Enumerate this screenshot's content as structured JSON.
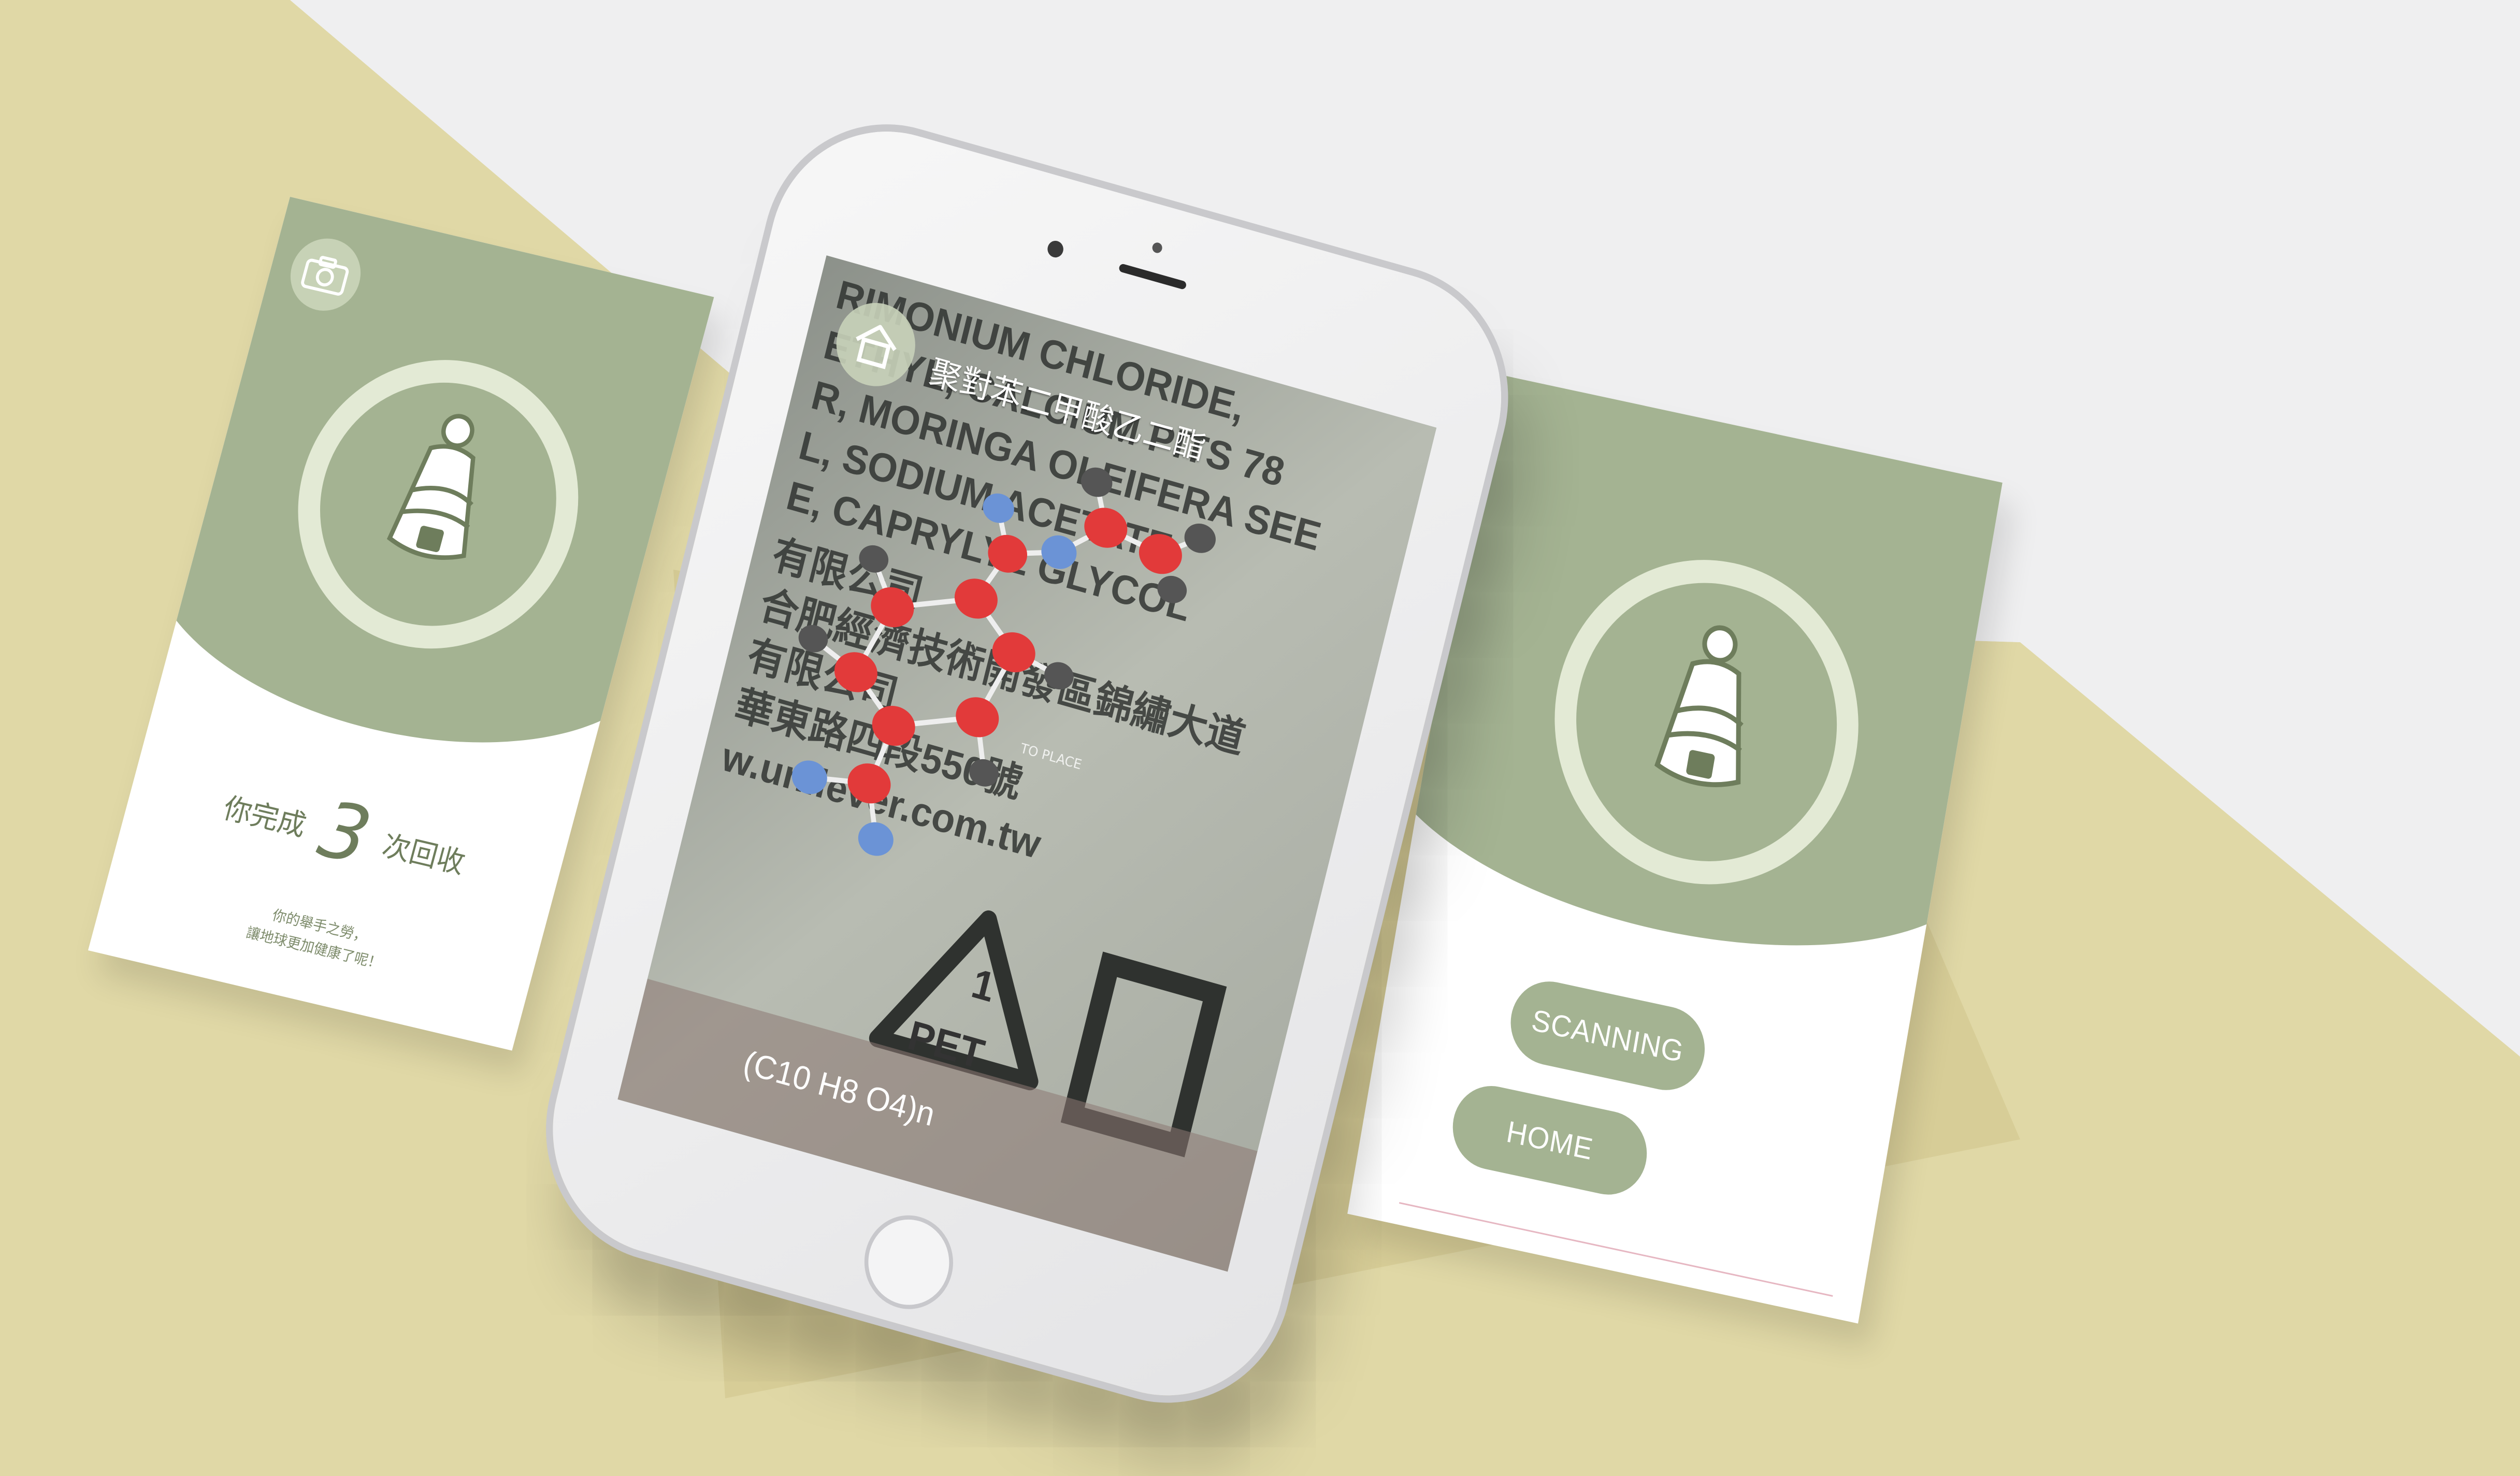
{
  "colors": {
    "page_background": "#efeff0",
    "khaki": "#e0d8a6",
    "sage": "#a4b392",
    "ring": "#e3ead5",
    "text_green": "#6e7d5c",
    "atom_oxygen": "#e23a3a",
    "atom_nitrogen": "#6b93d6",
    "atom_carbon": "#555555"
  },
  "left_card": {
    "camera_icon": "camera-icon",
    "bottle_icon": "bottle-recycle-icon",
    "done_prefix": "你完成",
    "done_count": "3",
    "done_suffix": "次回收",
    "message_line1": "你的舉手之勞，",
    "message_line2": "讓地球更加健康了呢！"
  },
  "phone_screen": {
    "home_icon": "home-icon",
    "compound_name": "聚對苯二甲酸乙二酯",
    "formula": "(C10 H8 O4)n",
    "tap_hint": "TO PLACE",
    "label_lines": [
      "RIMONIUM CHLORIDE,",
      "ETHYL, CALCIUM PITS 78",
      "R, MORINGA OLEIFERA SEE",
      "L, SODIUM ACETATE",
      "E, CAPRYLYL GLYCOL",
      "有限公司",
      "合肥經濟技術開發區錦繡大道",
      "有限公司",
      "華東路四段550號",
      "w.unilever.com.tw"
    ],
    "recycle_number": "1",
    "recycle_label": "PET"
  },
  "right_card": {
    "bottle_icon": "bottle-recycle-icon",
    "scanning_button": "SCANNING",
    "home_button": "HOME"
  }
}
